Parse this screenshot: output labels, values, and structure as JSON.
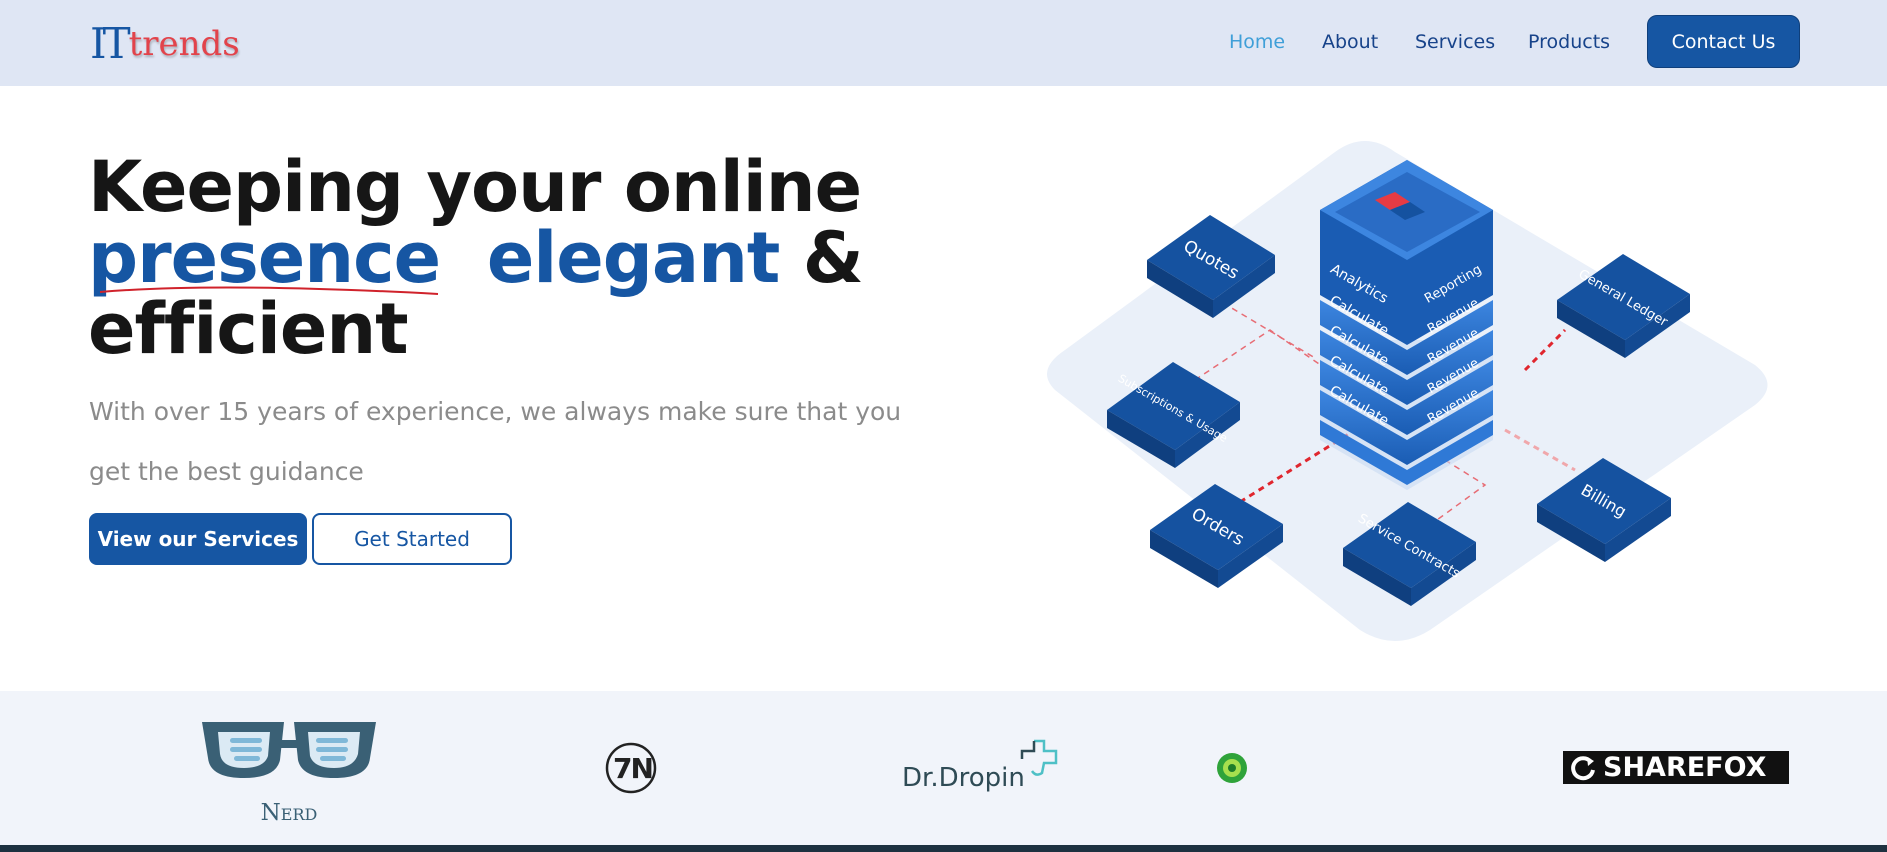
{
  "header": {
    "logo": {
      "part1": "IT",
      "part2": "trends"
    },
    "nav": [
      {
        "label": "Home",
        "active": true
      },
      {
        "label": "About",
        "active": false
      },
      {
        "label": "Services",
        "active": false
      },
      {
        "label": "Products",
        "active": false
      }
    ],
    "contact_label": "Contact Us"
  },
  "hero": {
    "title_line1": "Keeping your online",
    "title_word_presence": "presence",
    "title_word_elegant": "elegant",
    "title_amp": "&",
    "title_line3": "efficient",
    "subtitle": "With over 15 years of experience, we always make sure that you get the best guidance",
    "primary_button": "View our Services",
    "secondary_button": "Get Started"
  },
  "illustration": {
    "tiles": {
      "quotes": "Quotes",
      "subscriptions": "Subscriptions & Usage",
      "orders": "Orders",
      "service_contracts": "Service Contracts",
      "billing": "Billing",
      "general_ledger": "General Ledger"
    },
    "stack_top_left": "Analytics",
    "stack_top_right": "Reporting",
    "stack_left": "Calculate",
    "stack_right": "Revenue"
  },
  "partners": {
    "nerd": "Nerd",
    "sevenn": "7N",
    "drdropin": "Dr.Dropin",
    "sharefox": "SHAREFOX"
  },
  "colors": {
    "brand_blue": "#1656a3",
    "brand_red": "#e2434b",
    "nav_active": "#3f9fd8",
    "header_bg": "#dfe6f4"
  }
}
